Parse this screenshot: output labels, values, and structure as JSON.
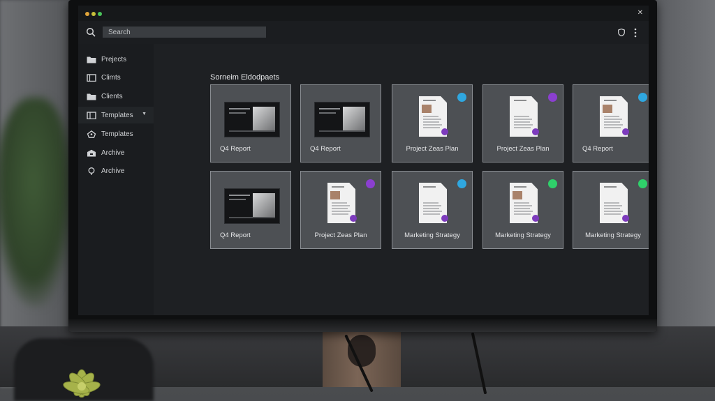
{
  "app": {
    "search": {
      "placeholder": "Search"
    },
    "sidebar": {
      "items": [
        {
          "label": "Prejects",
          "icon": "folder-icon"
        },
        {
          "label": "Climts",
          "icon": "archive-box-icon"
        },
        {
          "label": "Clients",
          "icon": "folder-icon"
        },
        {
          "label": "Templates",
          "icon": "template-icon",
          "expandable": true
        },
        {
          "label": "Templates",
          "icon": "tag-icon"
        },
        {
          "label": "Archive",
          "icon": "archive-icon"
        },
        {
          "label": "Archive",
          "icon": "bulb-icon"
        }
      ]
    },
    "main": {
      "heading": "Sorneim Eldodpaets",
      "cards": [
        {
          "label": "Q4 Report",
          "thumb": "screen",
          "dot": ""
        },
        {
          "label": "Q4 Report",
          "thumb": "screen",
          "dot": ""
        },
        {
          "label": "Project Zeas Plan",
          "thumb": "doc",
          "dot": "#2fa7e0"
        },
        {
          "label": "Project Zeas Plan",
          "thumb": "doc",
          "dot": "#8b3fd0"
        },
        {
          "label": "Q4 Report",
          "thumb": "doc",
          "dot": "#2fa7e0"
        },
        {
          "label": "Q4 Report",
          "thumb": "screen",
          "dot": ""
        },
        {
          "label": "Project Zeas Plan",
          "thumb": "doc",
          "dot": "#8b3fd0"
        },
        {
          "label": "Marketing Strategy",
          "thumb": "doc",
          "dot": "#2fa7e0"
        },
        {
          "label": "Marketing Strategy",
          "thumb": "doc",
          "dot": "#2fd06a"
        },
        {
          "label": "Marketing Strategy",
          "thumb": "doc",
          "dot": "#2fd06a"
        }
      ]
    },
    "colors": {
      "accent_purple": "#7d3bbd",
      "status_blue": "#2fa7e0",
      "status_green": "#2fd06a"
    }
  }
}
